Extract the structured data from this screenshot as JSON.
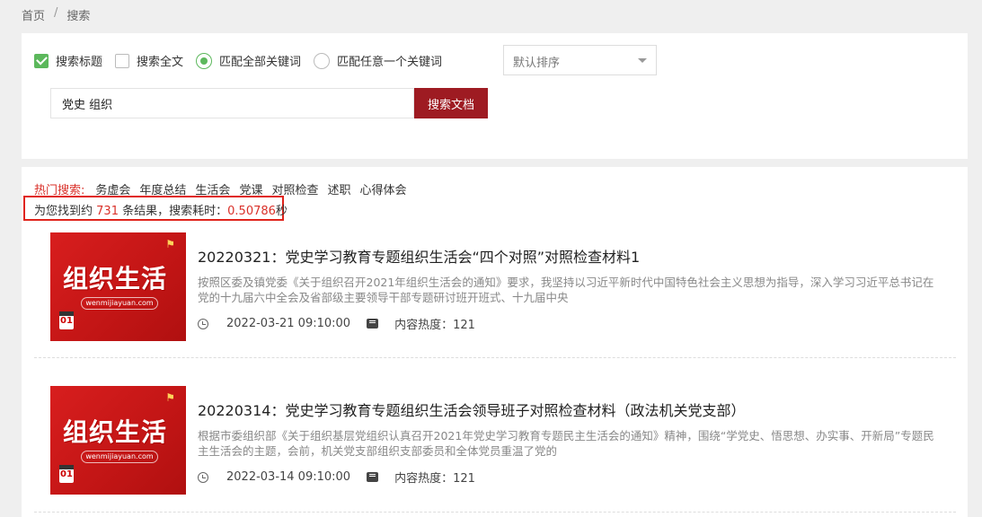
{
  "breadcrumb": {
    "home": "首页",
    "separator": "/",
    "current": "搜索"
  },
  "filters": {
    "search_title": "搜索标题",
    "search_fulltext": "搜索全文",
    "match_all": "匹配全部关键词",
    "match_any": "匹配任意一个关键词",
    "sort_value": "默认排序"
  },
  "search": {
    "query": "党史 组织",
    "button": "搜索文档"
  },
  "hot": {
    "label": "热门搜索:",
    "tags": [
      "务虚会",
      "年度总结",
      "生活会",
      "党课",
      "对照检查",
      "述职",
      "心得体会"
    ]
  },
  "summary": {
    "prefix": "为您找到约",
    "count": "731",
    "middle": "条结果，搜索耗时：",
    "time": "0.50786",
    "suffix": "秒"
  },
  "results": [
    {
      "thumb_title": "组织生活",
      "thumb_site": "wenmijiayuan.com",
      "thumb_cal": "01",
      "title": "20220321：党史学习教育专题组织生活会“四个对照”对照检查材料1",
      "desc": "按照区委及镇党委《关于组织召开2021年组织生活会的通知》要求，我坚持以习近平新时代中国特色社会主义思想为指导，深入学习习近平总书记在党的十九届六中全会及省部级主要领导干部专题研讨班开班式、十九届中央",
      "date": "2022-03-21 09:10:00",
      "heat": "内容热度：121"
    },
    {
      "thumb_title": "组织生活",
      "thumb_site": "wenmijiayuan.com",
      "thumb_cal": "01",
      "title": "20220314：党史学习教育专题组织生活会领导班子对照检查材料（政法机关党支部）",
      "desc": "根据市委组织部《关于组织基层党组织认真召开2021年党史学习教育专题民主生活会的通知》精神，围绕“学党史、悟思想、办实事、开新局”专题民主生活会的主题，会前，机关党支部组织支部委员和全体党员重温了党的",
      "date": "2022-03-14 09:10:00",
      "heat": "内容热度：121"
    }
  ]
}
